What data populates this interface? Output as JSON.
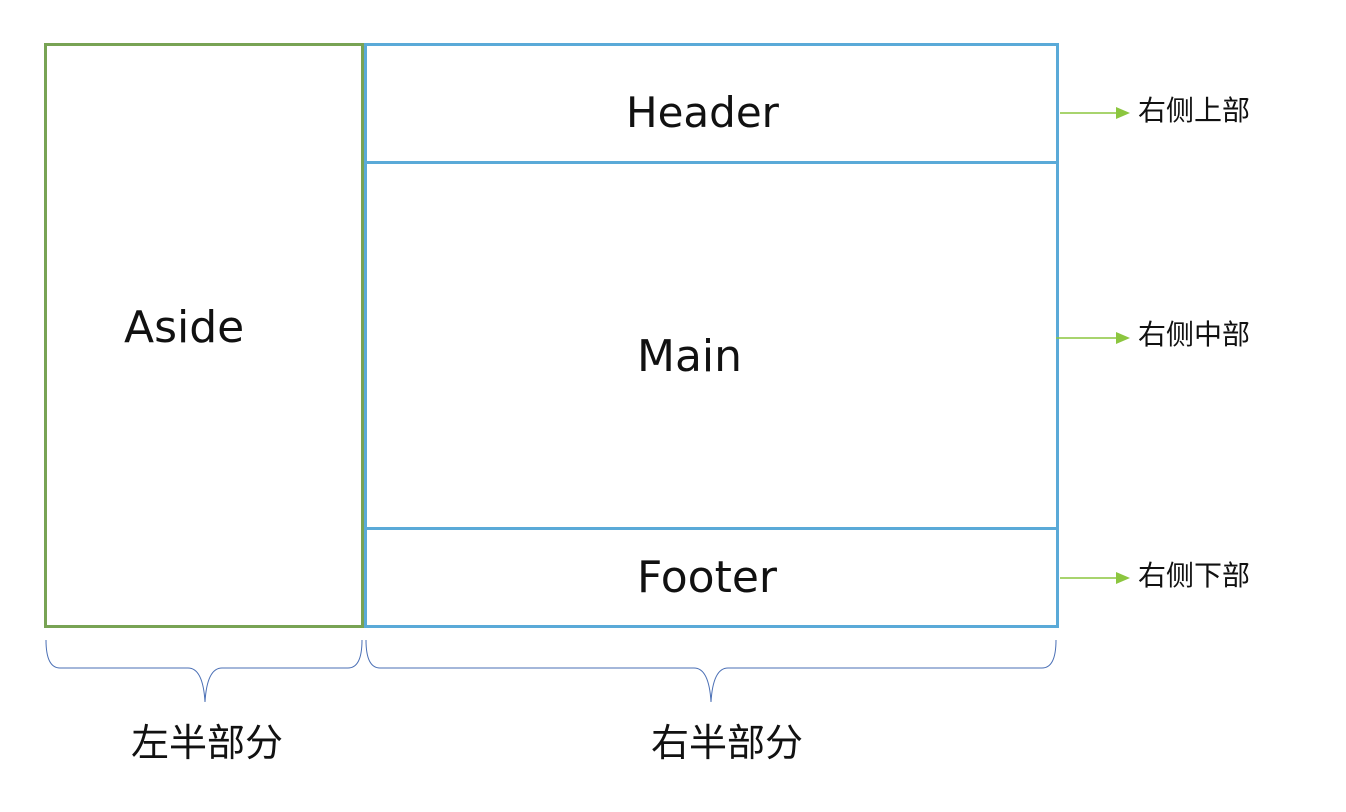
{
  "blocks": {
    "aside": "Aside",
    "header": "Header",
    "main": "Main",
    "footer": "Footer"
  },
  "side_notes": {
    "top": "右侧上部",
    "middle": "右侧中部",
    "bottom": "右侧下部"
  },
  "halves": {
    "left": "左半部分",
    "right": "右半部分"
  },
  "colors": {
    "aside_border": "#78a354",
    "right_border": "#5aaad8",
    "arrow": "#8cc63f",
    "brace": "#4a6fb5"
  }
}
